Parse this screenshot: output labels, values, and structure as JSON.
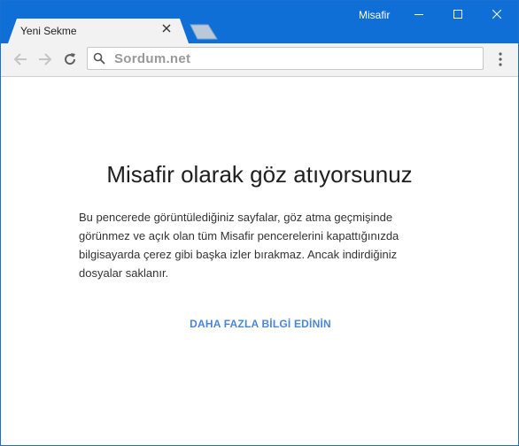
{
  "window": {
    "profile_label": "Misafir",
    "accent_color": "#0f6fd6"
  },
  "tabs": [
    {
      "title": "Yeni Sekme",
      "active": true
    }
  ],
  "toolbar": {
    "address": "Sordum.net",
    "icons": {
      "back": "arrow-left-icon",
      "forward": "arrow-right-icon",
      "reload": "reload-icon",
      "search": "search-icon",
      "menu": "more-vert-icon"
    }
  },
  "content": {
    "heading": "Misafir olarak göz atıyorsunuz",
    "description": "Bu pencerede görüntülediğiniz sayfalar, göz atma geçmişinde görünmez ve açık olan tüm Misafir pencerelerini kapattığınızda bilgisayarda çerez gibi başka izler bırakmaz. Ancak indirdiğiniz dosyalar saklanır.",
    "learn_more": "DAHA FAZLA BİLGİ EDİNİN",
    "link_color": "#4a86d8"
  }
}
